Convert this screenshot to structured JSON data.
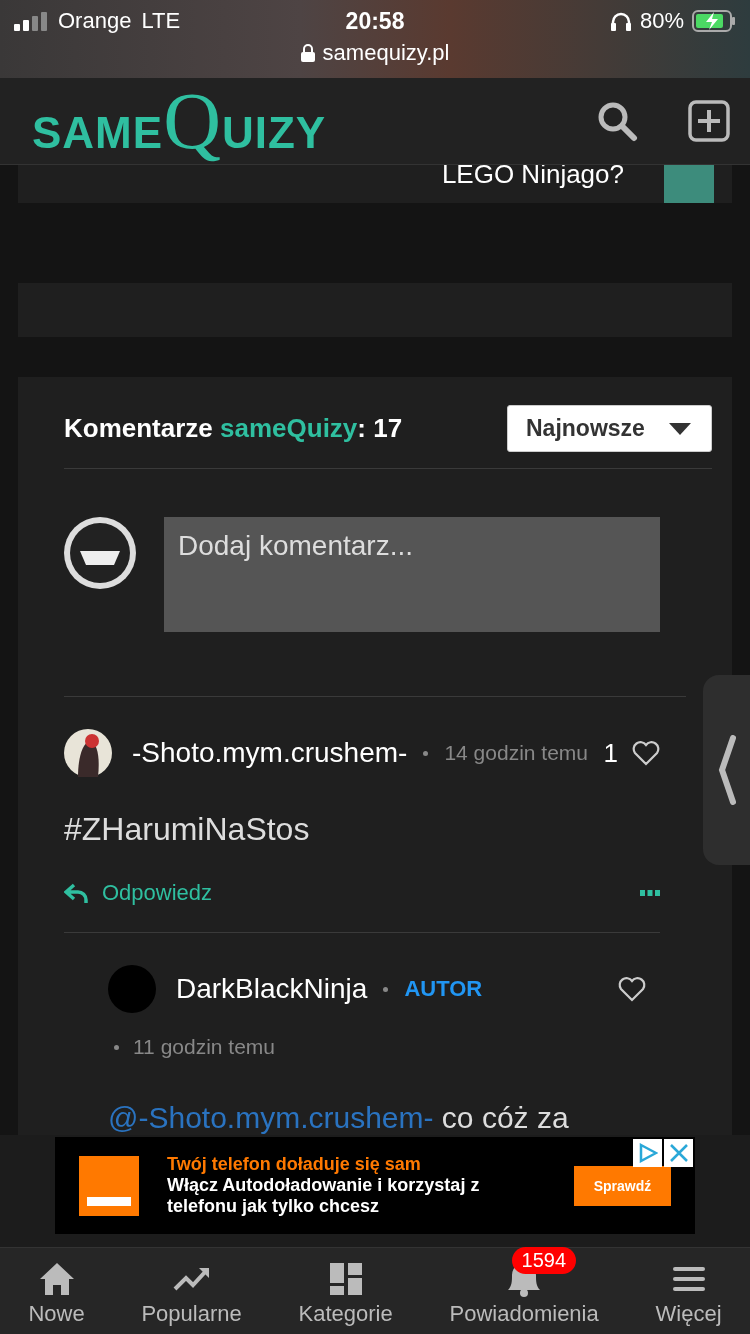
{
  "status_bar": {
    "carrier": "Orange",
    "network": "LTE",
    "time": "20:58",
    "battery": "80%",
    "url": "samequizy.pl"
  },
  "header": {
    "logo": "SAME**Q**UIZY"
  },
  "teaser": {
    "text": "LEGO Ninjago?"
  },
  "comments_section": {
    "title": "Komentarze *sameQuizy*: 17",
    "sort": "Najnowsze",
    "placeholder": "Dodaj komentarz...",
    "comments": [
      {
        "author": "-Shoto.mym.crushem-",
        "time": "14 godzin temu",
        "likes": "1",
        "liked": false,
        "text": "#ZHarumiNaStos",
        "reply": "Odpowiedz",
        "children": [
          {
            "author": "DarkBlackNinja",
            "badge": "AUTOR",
            "time": "11 godzin temu",
            "liked": false,
            "mention": "@-Shoto.mym.crushem-",
            "text": "co cóż za"
          }
        ]
      }
    ]
  },
  "ad": {
    "headline": "Twój telefon doładuje się sam",
    "body": "Włącz Autodoładowanie i korzystaj z telefonu jak tylko chcesz",
    "button": "Sprawdź"
  },
  "nav": [
    {
      "kind": "home",
      "label": "Nowe"
    },
    {
      "kind": "trend",
      "label": "Popularne"
    },
    {
      "kind": "grid",
      "label": "Kategorie"
    },
    {
      "kind": "bell",
      "label": "Powiadomienia",
      "badge": "1594"
    },
    {
      "kind": "menu",
      "label": "Więcej"
    }
  ]
}
